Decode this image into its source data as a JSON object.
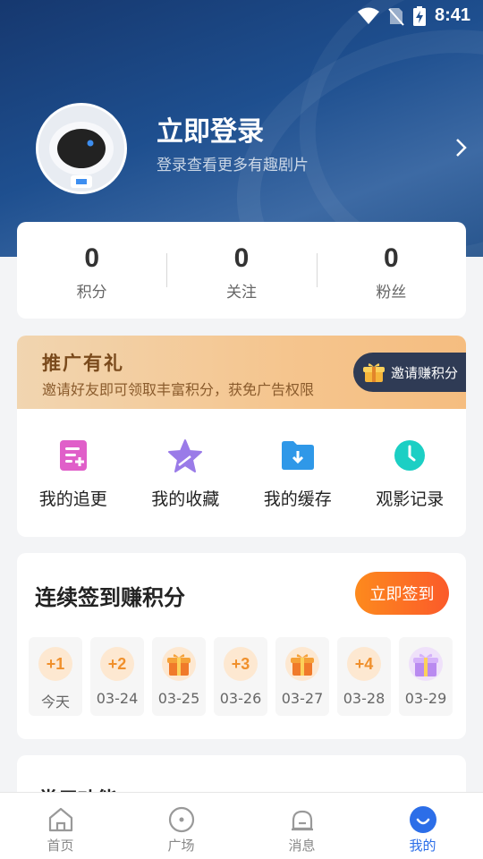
{
  "status_bar": {
    "time": "8:41"
  },
  "profile": {
    "title": "立即登录",
    "subtitle": "登录查看更多有趣剧片"
  },
  "stats": [
    {
      "value": "0",
      "label": "积分"
    },
    {
      "value": "0",
      "label": "关注"
    },
    {
      "value": "0",
      "label": "粉丝"
    }
  ],
  "promo": {
    "title": "推广有礼",
    "description": "邀请好友即可领取丰富积分，获免广告权限",
    "button": "邀请赚积分"
  },
  "functions": [
    {
      "label": "我的追更",
      "icon": "edit-list-icon"
    },
    {
      "label": "我的收藏",
      "icon": "star-icon"
    },
    {
      "label": "我的缓存",
      "icon": "download-folder-icon"
    },
    {
      "label": "观影记录",
      "icon": "clock-icon"
    }
  ],
  "signin": {
    "title": "连续签到赚积分",
    "button": "立即签到",
    "days": [
      {
        "reward": "+1",
        "label": "今天",
        "type": "points"
      },
      {
        "reward": "+2",
        "label": "03-24",
        "type": "points"
      },
      {
        "reward": "",
        "label": "03-25",
        "type": "gift"
      },
      {
        "reward": "+3",
        "label": "03-26",
        "type": "points"
      },
      {
        "reward": "",
        "label": "03-27",
        "type": "gift"
      },
      {
        "reward": "+4",
        "label": "03-28",
        "type": "points"
      },
      {
        "reward": "",
        "label": "03-29",
        "type": "big-gift"
      }
    ]
  },
  "common": {
    "title": "常用功能"
  },
  "tabs": [
    {
      "label": "首页",
      "icon": "home-icon"
    },
    {
      "label": "广场",
      "icon": "plaza-icon"
    },
    {
      "label": "消息",
      "icon": "bell-icon"
    },
    {
      "label": "我的",
      "icon": "profile-icon",
      "active": true
    }
  ],
  "colors": {
    "accent": "#2c6ee8",
    "signin_orange": "#fb6a25",
    "hero_blue": "#1e4f8f"
  }
}
